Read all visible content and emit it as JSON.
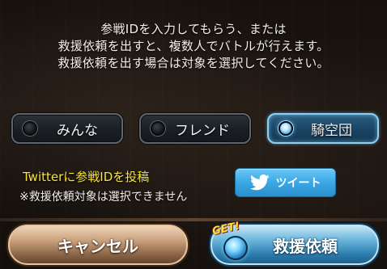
{
  "message": {
    "line1": "参戦IDを入力してもらう、または",
    "line2": "救援依頼を出すと、複数人でバトルが行えます。",
    "line3": "救援依頼を出す場合は対象を選択してください。"
  },
  "targets": [
    {
      "label": "みんな",
      "selected": false
    },
    {
      "label": "フレンド",
      "selected": false
    },
    {
      "label": "騎空団",
      "selected": true
    }
  ],
  "twitter": {
    "post_text": "Twitterに参戦IDを投稿",
    "note": "※救援依頼対象は選択できません",
    "tweet_label": "ツイート",
    "icon": "twitter-bird-icon"
  },
  "buttons": {
    "cancel_label": "キャンセル",
    "rescue_label": "救援依頼",
    "badge": "GET!"
  },
  "colors": {
    "highlight_text": "#f7e33c",
    "tweet_blue": "#3aa8e6",
    "selected_blue": "#8fd0f2"
  }
}
